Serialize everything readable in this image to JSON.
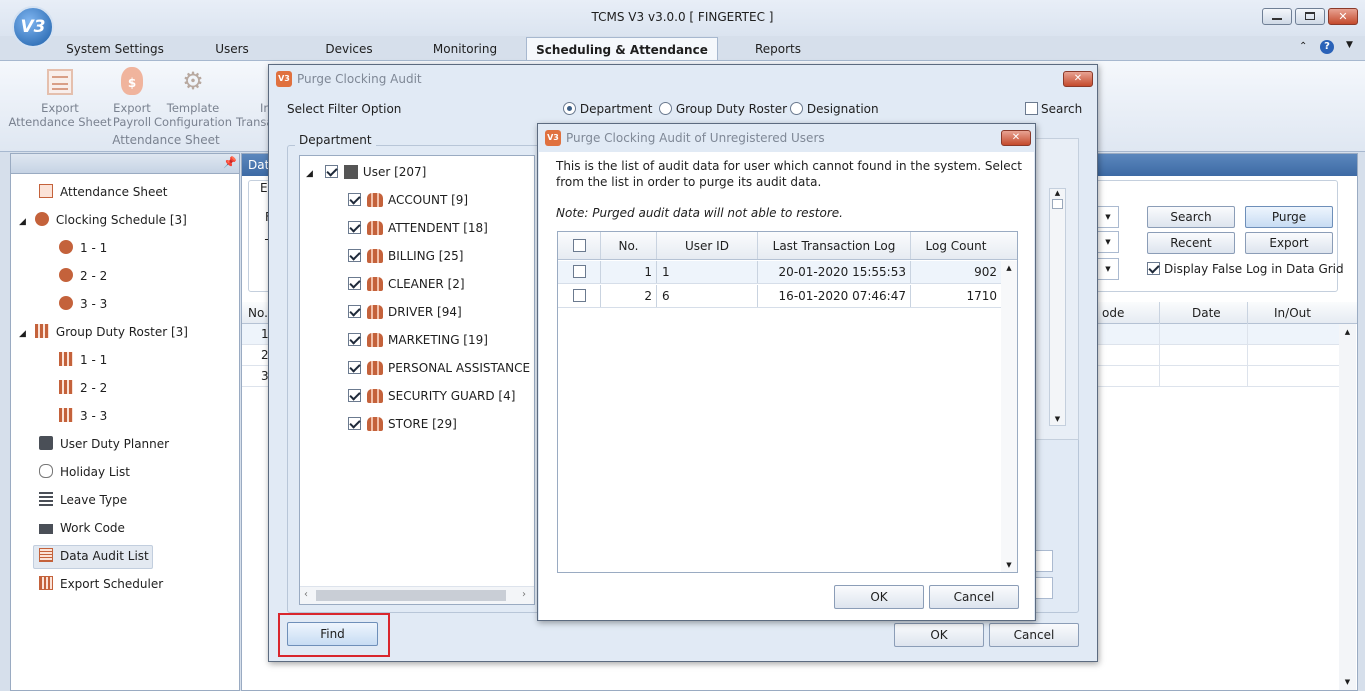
{
  "app": {
    "title": "TCMS V3 v3.0.0 [ FINGERTEC ]"
  },
  "menu_tabs": [
    "System Settings",
    "Users",
    "Devices",
    "Monitoring",
    "Scheduling & Attendance",
    "Reports"
  ],
  "ribbon": {
    "buttons": [
      {
        "line1": "Export",
        "line2": "Attendance Sheet"
      },
      {
        "line1": "Export",
        "line2": "Payroll"
      },
      {
        "line1": "Template",
        "line2": "Configuration"
      },
      {
        "line1": "In",
        "line2": "Transa"
      }
    ],
    "group_label": "Attendance Sheet"
  },
  "nav": {
    "items": [
      {
        "label": "Attendance Sheet",
        "icon": "sheet-icon"
      },
      {
        "label": "Clocking Schedule [3]",
        "icon": "clock-icon"
      },
      {
        "label": "1 - 1",
        "icon": "clock-icon"
      },
      {
        "label": "2 - 2",
        "icon": "clock-icon"
      },
      {
        "label": "3 - 3",
        "icon": "clock-icon"
      },
      {
        "label": "Group Duty Roster [3]",
        "icon": "roster-icon"
      },
      {
        "label": "1 - 1",
        "icon": "roster-icon"
      },
      {
        "label": "2 - 2",
        "icon": "roster-icon"
      },
      {
        "label": "3 - 3",
        "icon": "roster-icon"
      },
      {
        "label": "User Duty Planner",
        "icon": "briefcase-icon"
      },
      {
        "label": "Holiday List",
        "icon": "flipflop-icon"
      },
      {
        "label": "Leave Type",
        "icon": "table-icon"
      },
      {
        "label": "Work Code",
        "icon": "monitor-icon"
      },
      {
        "label": "Data Audit List",
        "icon": "list-icon"
      },
      {
        "label": "Export Scheduler",
        "icon": "calendar-icon"
      }
    ],
    "selected": "Data Audit List"
  },
  "main": {
    "header_fragment": "Data",
    "fragments": {
      "en": "Er",
      "f": "F",
      "t": "T"
    },
    "buttons": {
      "search": "Search",
      "purge": "Purge",
      "recent": "Recent",
      "export": "Export"
    },
    "display_false_log": "Display False Log in Data Grid",
    "grid": {
      "no_col": "No.",
      "code_col": "ode",
      "date_col": "Date",
      "inout_col": "In/Out",
      "row_numbers": [
        "1",
        "2",
        "3"
      ]
    }
  },
  "purge_dialog": {
    "title": "Purge Clocking Audit",
    "filter_label": "Select Filter Option",
    "filter_options": [
      "Department",
      "Group Duty Roster",
      "Designation"
    ],
    "selected_filter": "Department",
    "search_label": "Search",
    "group_label": "Department",
    "tree_root": "User [207]",
    "departments": [
      "ACCOUNT [9]",
      "ATTENDENT [18]",
      "BILLING [25]",
      "CLEANER [2]",
      "DRIVER [94]",
      "MARKETING [19]",
      "PERSONAL ASSISTANCE [1]",
      "SECURITY GUARD [4]",
      "STORE [29]"
    ],
    "find_button": "Find",
    "ok_button": "OK",
    "cancel_button": "Cancel"
  },
  "unregistered_dialog": {
    "title": "Purge Clocking Audit of Unregistered Users",
    "description": "This is the list of audit data for user which cannot found in the system. Select from the list in order to purge its audit data.",
    "note": "Note: Purged audit data will not able to restore.",
    "columns": [
      "No.",
      "User ID",
      "Last Transaction Log",
      "Log Count"
    ],
    "rows": [
      {
        "no": "1",
        "user_id": "1",
        "last_log": "20-01-2020 15:55:53",
        "count": "902"
      },
      {
        "no": "2",
        "user_id": "6",
        "last_log": "16-01-2020 07:46:47",
        "count": "1710"
      }
    ],
    "ok_button": "OK",
    "cancel_button": "Cancel"
  },
  "colors": {
    "highlight_box": "#d9262c",
    "header_blue": "#3d6aa4",
    "dialog_bg": "#e1eaf5"
  }
}
